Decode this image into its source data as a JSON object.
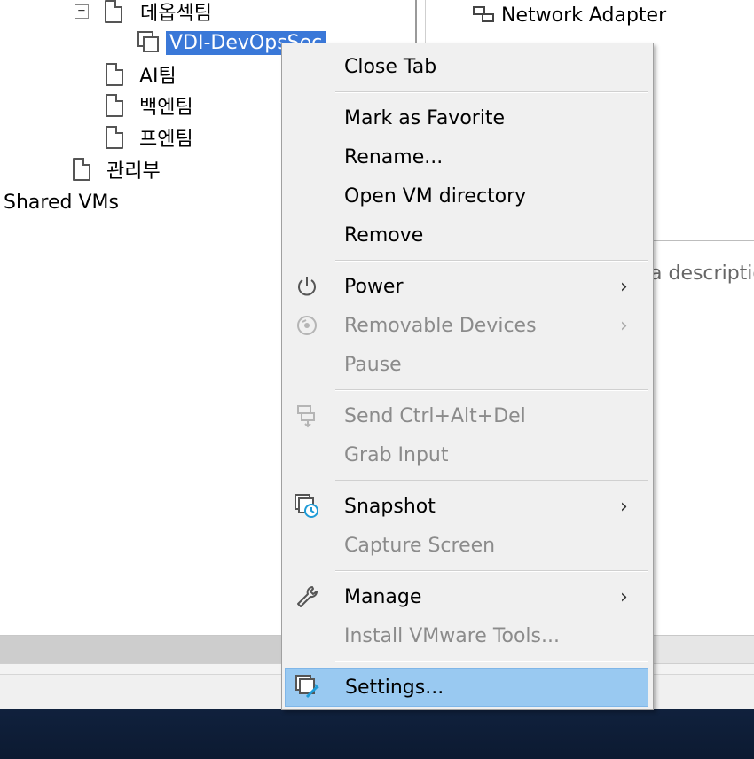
{
  "tree": {
    "items": [
      {
        "label": "데옵섹팀"
      },
      {
        "label": "VDI-DevOpsSec"
      },
      {
        "label": "AI팀"
      },
      {
        "label": "백엔팀"
      },
      {
        "label": "프엔팀"
      },
      {
        "label": "관리부"
      },
      {
        "label": "Shared VMs"
      }
    ],
    "expander_symbol": "−"
  },
  "hardware": {
    "network_adapter": "Network Adapter"
  },
  "description": {
    "placeholder": "a descriptio"
  },
  "context_menu": {
    "items": [
      {
        "label": "Close Tab",
        "enabled": true
      },
      {
        "label": "Mark as Favorite",
        "enabled": true
      },
      {
        "label": "Rename...",
        "enabled": true
      },
      {
        "label": "Open VM directory",
        "enabled": true
      },
      {
        "label": "Remove",
        "enabled": true
      },
      {
        "label": "Power",
        "enabled": true,
        "submenu": true,
        "icon": "power-icon"
      },
      {
        "label": "Removable Devices",
        "enabled": false,
        "submenu": true,
        "icon": "removable-devices-icon"
      },
      {
        "label": "Pause",
        "enabled": false
      },
      {
        "label": "Send Ctrl+Alt+Del",
        "enabled": false,
        "icon": "send-keys-icon"
      },
      {
        "label": "Grab Input",
        "enabled": false
      },
      {
        "label": "Snapshot",
        "enabled": true,
        "submenu": true,
        "icon": "snapshot-icon"
      },
      {
        "label": "Capture Screen",
        "enabled": false
      },
      {
        "label": "Manage",
        "enabled": true,
        "submenu": true,
        "icon": "wrench-icon"
      },
      {
        "label": "Install VMware Tools...",
        "enabled": false
      },
      {
        "label": "Settings...",
        "enabled": true,
        "highlighted": true,
        "icon": "settings-icon"
      }
    ],
    "submenu_arrow": "›"
  },
  "colors": {
    "selection": "#3a78d8",
    "menu_highlight": "#99c9f1",
    "menu_background": "#f0f0f0",
    "taskbar": "#10213d"
  }
}
